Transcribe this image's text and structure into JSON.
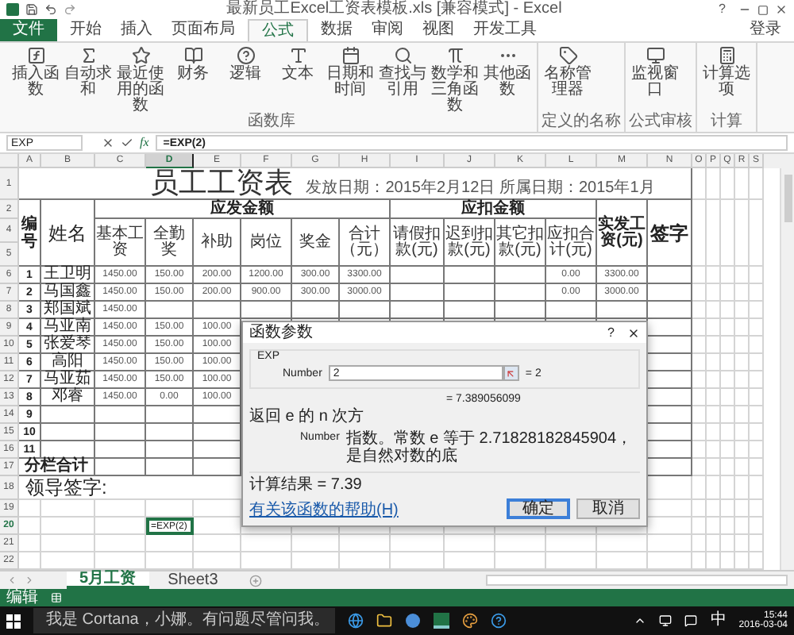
{
  "window": {
    "title": "最新员工Excel工资表模板.xls [兼容模式] - Excel",
    "help": "?"
  },
  "account": "登录",
  "ribbon_tabs": [
    {
      "label": "文件",
      "kind": "file",
      "selected": false
    },
    {
      "label": "开始",
      "kind": "tab",
      "selected": false
    },
    {
      "label": "插入",
      "kind": "tab",
      "selected": false
    },
    {
      "label": "页面布局",
      "kind": "tab",
      "selected": false
    },
    {
      "label": "公式",
      "kind": "tab",
      "selected": true
    },
    {
      "label": "数据",
      "kind": "tab",
      "selected": false
    },
    {
      "label": "审阅",
      "kind": "tab",
      "selected": false
    },
    {
      "label": "视图",
      "kind": "tab",
      "selected": false
    },
    {
      "label": "开发工具",
      "kind": "tab",
      "selected": false
    }
  ],
  "ribbon_groups": [
    {
      "label": "函数库",
      "buttons": [
        {
          "label": "插入函数"
        },
        {
          "label": "自动求和"
        },
        {
          "label": "最近使用的函数"
        },
        {
          "label": "财务"
        },
        {
          "label": "逻辑"
        },
        {
          "label": "文本"
        },
        {
          "label": "日期和时间"
        },
        {
          "label": "查找与引用"
        },
        {
          "label": "数学和三角函数"
        },
        {
          "label": "其他函数"
        }
      ]
    },
    {
      "label": "定义的名称",
      "buttons": [
        {
          "label": "名称管理器"
        }
      ]
    },
    {
      "label": "公式审核",
      "buttons": [
        {
          "label": "监视窗口"
        }
      ]
    },
    {
      "label": "计算",
      "buttons": [
        {
          "label": "计算选项"
        }
      ]
    }
  ],
  "formula_bar": {
    "name_box": "EXP",
    "fx": "fx",
    "formula": "=EXP(2)"
  },
  "columns": [
    {
      "letter": "A",
      "selected": false
    },
    {
      "letter": "B",
      "selected": false
    },
    {
      "letter": "C",
      "selected": false
    },
    {
      "letter": "D",
      "selected": true
    },
    {
      "letter": "E",
      "selected": false
    },
    {
      "letter": "F",
      "selected": false
    },
    {
      "letter": "G",
      "selected": false
    },
    {
      "letter": "H",
      "selected": false
    },
    {
      "letter": "I",
      "selected": false
    },
    {
      "letter": "J",
      "selected": false
    },
    {
      "letter": "K",
      "selected": false
    },
    {
      "letter": "L",
      "selected": false
    },
    {
      "letter": "M",
      "selected": false
    },
    {
      "letter": "N",
      "selected": false
    },
    {
      "letter": "O",
      "selected": false
    },
    {
      "letter": "P",
      "selected": false
    },
    {
      "letter": "Q",
      "selected": false
    },
    {
      "letter": "R",
      "selected": false
    },
    {
      "letter": "S",
      "selected": false
    }
  ],
  "sheet": {
    "title_row": "1",
    "title": "员工工资表",
    "subtitle": "发放日期：2015年2月12日 所属日期：2015年1月",
    "header_rows": [
      "2",
      "4",
      "5"
    ],
    "headers": {
      "number": "编号",
      "name": "姓名",
      "earnings": "应发金额",
      "deductions": "应扣金额",
      "net": "实发工资(元)",
      "signature": "签字",
      "sub": [
        "基本工资",
        "全勤奖",
        "补助",
        "岗位",
        "奖金",
        "合计（元）",
        "请假扣款(元)",
        "迟到扣款(元)",
        "其它扣款(元)",
        "应扣合计(元)"
      ]
    },
    "rows": [
      {
        "row": "6",
        "number": "1",
        "name": "王卫明",
        "values": {
          "C": "1450.00",
          "D": "150.00",
          "E": "200.00",
          "F": "1200.00",
          "G": "300.00",
          "H": "3300.00",
          "L": "0.00",
          "M": "3300.00"
        }
      },
      {
        "row": "7",
        "number": "2",
        "name": "马国鑫",
        "values": {
          "C": "1450.00",
          "D": "150.00",
          "E": "200.00",
          "F": "900.00",
          "G": "300.00",
          "H": "3000.00",
          "L": "0.00",
          "M": "3000.00"
        }
      },
      {
        "row": "8",
        "number": "3",
        "name": "郑国斌",
        "values": {
          "C": "1450.00"
        }
      },
      {
        "row": "9",
        "number": "4",
        "name": "马亚南",
        "values": {
          "C": "1450.00",
          "D": "150.00",
          "E": "100.00"
        }
      },
      {
        "row": "10",
        "number": "5",
        "name": "张爱琴",
        "values": {
          "C": "1450.00",
          "D": "150.00",
          "E": "100.00"
        }
      },
      {
        "row": "11",
        "number": "6",
        "name": "高阳",
        "values": {
          "C": "1450.00",
          "D": "150.00",
          "E": "100.00"
        }
      },
      {
        "row": "12",
        "number": "7",
        "name": "马亚茹",
        "values": {
          "C": "1450.00",
          "D": "150.00",
          "E": "100.00"
        }
      },
      {
        "row": "13",
        "number": "8",
        "name": "邓睿",
        "values": {
          "C": "1450.00",
          "D": "0.00",
          "E": "100.00"
        }
      },
      {
        "row": "14",
        "number": "9"
      },
      {
        "row": "15",
        "number": "10"
      },
      {
        "row": "16",
        "number": "11"
      }
    ],
    "total_row": {
      "row": "17",
      "label": "分栏合计"
    },
    "signature_row": {
      "row": "18",
      "label": "领导签字:"
    },
    "extra_rows": [
      {
        "row": "19",
        "selected": false
      },
      {
        "row": "20",
        "selected": true,
        "content": "=EXP(2)"
      },
      {
        "row": "21",
        "selected": false
      },
      {
        "row": "22",
        "selected": false
      }
    ]
  },
  "dialog": {
    "title": "函数参数",
    "help": "?",
    "function": "EXP",
    "argument": {
      "label": "Number",
      "value": "2",
      "result": "= 2"
    },
    "result_preview": "= 7.389056099",
    "description": "返回 e 的 n 次方",
    "argument_help_label": "Number",
    "argument_help": "指数。常数 e 等于 2.71828182845904，是自然对数的底",
    "formula_result": "计算结果 = 7.39",
    "help_link": "有关该函数的帮助(H)",
    "buttons": [
      {
        "label": "确定",
        "kind": "primary"
      },
      {
        "label": "取消",
        "kind": "default"
      }
    ]
  },
  "sheet_tabs": [
    {
      "label": "5月工资",
      "selected": true
    },
    {
      "label": "Sheet3",
      "selected": false
    }
  ],
  "status_bar": {
    "mode": "编辑"
  },
  "taskbar": {
    "search": "我是 Cortana，小娜。有问题尽管问我。",
    "ime": "中",
    "time": "15:44",
    "date": "2016-03-04"
  }
}
